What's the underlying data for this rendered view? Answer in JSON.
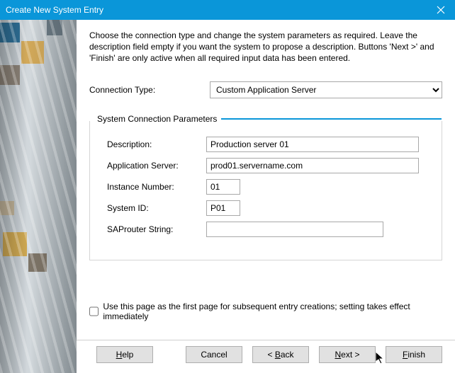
{
  "window": {
    "title": "Create New System Entry"
  },
  "intro": "Choose the connection type and change the system parameters as required. Leave the description field empty if you want the system to propose a description. Buttons 'Next >' and 'Finish' are only active when all required input data has been entered.",
  "connection": {
    "label": "Connection Type:",
    "selected": "Custom Application Server"
  },
  "group": {
    "title": "System Connection Parameters",
    "description": {
      "label": "Description:",
      "value": "Production server 01"
    },
    "appserver": {
      "label": "Application Server:",
      "value": "prod01.servername.com"
    },
    "instance": {
      "label": "Instance Number:",
      "value": "01"
    },
    "systemid": {
      "label": "System ID:",
      "value": "P01"
    },
    "saprouter": {
      "label": "SAProuter String:",
      "value": ""
    }
  },
  "checkbox": {
    "label": "Use this page as the first page for subsequent entry creations; setting takes effect immediately",
    "checked": false
  },
  "buttons": {
    "help": {
      "pre": "",
      "u": "H",
      "post": "elp"
    },
    "cancel": {
      "pre": "Cancel",
      "u": "",
      "post": ""
    },
    "back": {
      "pre": "< ",
      "u": "B",
      "post": "ack"
    },
    "next": {
      "pre": "",
      "u": "N",
      "post": "ext >"
    },
    "finish": {
      "pre": "",
      "u": "F",
      "post": "inish"
    }
  }
}
